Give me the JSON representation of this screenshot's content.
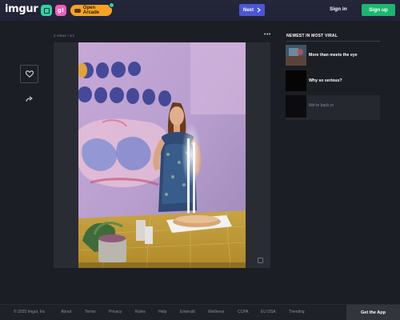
{
  "header": {
    "logo": "imgur",
    "arcade_label": "Open Arcade",
    "next_label": "Next",
    "signin_label": "Sign in",
    "signup_label": "Sign up",
    "icons": [
      "arcade-gamepad-icon",
      "chevron-right-icon",
      "heart-icon",
      "share-arrow-icon"
    ]
  },
  "post": {
    "meta": "0 Views • 1m",
    "more": "•••"
  },
  "sidebar_right": {
    "title": "NEWEST IN MOST VIRAL",
    "items": [
      {
        "title": "More than meets the eye"
      },
      {
        "title": "Why so serious?"
      },
      {
        "title": "We're back in"
      }
    ]
  },
  "footer": {
    "links": [
      "© 2025 Imgur, Inc",
      "About",
      "Terms",
      "Privacy",
      "Rules",
      "Help",
      "Emerald",
      "Wellness",
      "CCPA",
      "EU DSA",
      "Trending"
    ],
    "get_app": "Get the App"
  },
  "colors": {
    "topbar": "#212235",
    "next": "#4b56d8",
    "signup": "#1bb76e",
    "arcade": "#f9a323"
  }
}
